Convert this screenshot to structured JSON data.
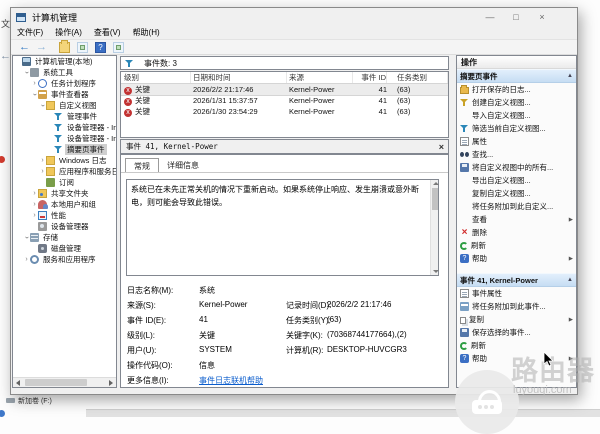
{
  "icons": {
    "chevron": "›",
    "submenu_arrow": "▶",
    "section_collapse": "▲",
    "critical_x": "x",
    "help_q": "?",
    "back_arrow": "←",
    "forward_arrow": "→"
  },
  "colors": {
    "accent_blue": "#3b6fc4",
    "critical_red": "#c23232",
    "link_blue": "#0a5ccc",
    "selection_gray": "#cfcfcf"
  },
  "titlebar": {
    "title": "计算机管理",
    "minimize": "—",
    "maximize": "□",
    "close": "×"
  },
  "menubar": {
    "items": [
      "文件(F)",
      "操作(A)",
      "查看(V)",
      "帮助(H)"
    ]
  },
  "tree": {
    "items": [
      {
        "label": "计算机管理(本地)",
        "level": 0,
        "expand": "",
        "icon": "computer",
        "selected": false
      },
      {
        "label": "系统工具",
        "level": 1,
        "expand": "v",
        "icon": "tools",
        "selected": false
      },
      {
        "label": "任务计划程序",
        "level": 2,
        "expand": ">",
        "icon": "scheduler",
        "selected": false
      },
      {
        "label": "事件查看器",
        "level": 2,
        "expand": "v",
        "icon": "eventvwr",
        "selected": false
      },
      {
        "label": "自定义视图",
        "level": 3,
        "expand": "v",
        "icon": "custom-views",
        "selected": false
      },
      {
        "label": "管理事件",
        "level": 4,
        "expand": "",
        "icon": "filter",
        "selected": false
      },
      {
        "label": "设备管理器 - Int",
        "level": 4,
        "expand": "",
        "icon": "filter",
        "selected": false
      },
      {
        "label": "设备管理器 - Int",
        "level": 4,
        "expand": "",
        "icon": "filter",
        "selected": false
      },
      {
        "label": "摘要页事件",
        "level": 4,
        "expand": "",
        "icon": "filter",
        "selected": true
      },
      {
        "label": "Windows 日志",
        "level": 3,
        "expand": ">",
        "icon": "folder",
        "selected": false
      },
      {
        "label": "应用程序和服务日志",
        "level": 3,
        "expand": ">",
        "icon": "folder",
        "selected": false
      },
      {
        "label": "订阅",
        "level": 3,
        "expand": "",
        "icon": "subscriptions",
        "selected": false
      },
      {
        "label": "共享文件夹",
        "level": 2,
        "expand": ">",
        "icon": "shared-folders",
        "selected": false
      },
      {
        "label": "本地用户和组",
        "level": 2,
        "expand": ">",
        "icon": "users",
        "selected": false
      },
      {
        "label": "性能",
        "level": 2,
        "expand": ">",
        "icon": "performance",
        "selected": false
      },
      {
        "label": "设备管理器",
        "level": 2,
        "expand": "",
        "icon": "device-manager",
        "selected": false
      },
      {
        "label": "存储",
        "level": 1,
        "expand": "v",
        "icon": "storage",
        "selected": false
      },
      {
        "label": "磁盘管理",
        "level": 2,
        "expand": "",
        "icon": "disk",
        "selected": false
      },
      {
        "label": "服务和应用程序",
        "level": 1,
        "expand": ">",
        "icon": "services",
        "selected": false
      }
    ]
  },
  "events": {
    "filter_label": "事件数: 3",
    "columns": [
      "级别",
      "日期和时间",
      "来源",
      "事件 ID",
      "任务类别"
    ],
    "rows": [
      {
        "level": "关键",
        "datetime": "2026/2/2 21:17:46",
        "source": "Kernel-Power",
        "event_id": "41",
        "task_category": "(63)",
        "selected": true
      },
      {
        "level": "关键",
        "datetime": "2026/1/31 15:37:57",
        "source": "Kernel-Power",
        "event_id": "41",
        "task_category": "(63)",
        "selected": false
      },
      {
        "level": "关键",
        "datetime": "2026/1/30 23:54:29",
        "source": "Kernel-Power",
        "event_id": "41",
        "task_category": "(63)",
        "selected": false
      }
    ]
  },
  "detail": {
    "title": "事件 41, Kernel-Power",
    "close": "×",
    "tabs": [
      {
        "label": "常规",
        "active": true
      },
      {
        "label": "详细信息",
        "active": false
      }
    ],
    "description": "系统已在未先正常关机的情况下重新启动。如果系统停止响应、发生崩溃或意外断电，则可能会导致此错误。",
    "fields": [
      {
        "label": "日志名称(M):",
        "value": "系统",
        "label2": "",
        "value2": "",
        "is_link": false
      },
      {
        "label": "来源(S):",
        "value": "Kernel-Power",
        "label2": "记录时间(D):",
        "value2": "2026/2/2 21:17:46",
        "is_link": false
      },
      {
        "label": "事件 ID(E):",
        "value": "41",
        "label2": "任务类别(Y):",
        "value2": "(63)",
        "is_link": false
      },
      {
        "label": "级别(L):",
        "value": "关键",
        "label2": "关键字(K):",
        "value2": "(70368744177664),(2)",
        "is_link": false
      },
      {
        "label": "用户(U):",
        "value": "SYSTEM",
        "label2": "计算机(R):",
        "value2": "DESKTOP-HUVCGR3",
        "is_link": false
      },
      {
        "label": "操作代码(O):",
        "value": "信息",
        "label2": "",
        "value2": "",
        "is_link": false
      },
      {
        "label": "更多信息(I):",
        "value": "事件日志联机帮助",
        "label2": "",
        "value2": "",
        "is_link": true
      }
    ]
  },
  "actions": {
    "title": "操作",
    "sections": [
      {
        "header": "摘要页事件",
        "items": [
          {
            "icon": "open-folder",
            "label": "打开保存的日志...",
            "submenu": false
          },
          {
            "icon": "filter-create",
            "label": "创建自定义视图...",
            "submenu": false
          },
          {
            "icon": "none",
            "label": "导入自定义视图...",
            "submenu": false
          },
          {
            "icon": "filter",
            "label": "筛选当前自定义视图...",
            "submenu": false
          },
          {
            "icon": "properties",
            "label": "属性",
            "submenu": false
          },
          {
            "icon": "find",
            "label": "查找...",
            "submenu": false
          },
          {
            "icon": "save",
            "label": "将自定义视图中的所有...",
            "submenu": false
          },
          {
            "icon": "none",
            "label": "导出自定义视图...",
            "submenu": false
          },
          {
            "icon": "none",
            "label": "复制自定义视图...",
            "submenu": false
          },
          {
            "icon": "none",
            "label": "将任务附加到此自定义...",
            "submenu": false
          },
          {
            "icon": "none",
            "label": "查看",
            "submenu": true
          },
          {
            "icon": "delete",
            "label": "删除",
            "submenu": false
          },
          {
            "icon": "refresh",
            "label": "刷新",
            "submenu": false
          },
          {
            "icon": "help",
            "label": "帮助",
            "submenu": true
          }
        ]
      },
      {
        "header": "事件 41, Kernel-Power",
        "items": [
          {
            "icon": "properties",
            "label": "事件属性",
            "submenu": false
          },
          {
            "icon": "task",
            "label": "将任务附加到此事件...",
            "submenu": false
          },
          {
            "icon": "copy",
            "label": "复制",
            "submenu": true
          },
          {
            "icon": "save",
            "label": "保存选择的事件...",
            "submenu": false
          },
          {
            "icon": "refresh",
            "label": "刷新",
            "submenu": false
          },
          {
            "icon": "help",
            "label": "帮助",
            "submenu": true
          }
        ]
      }
    ]
  },
  "background": {
    "fragment_text": "文",
    "volume_label": "新加卷 (F:)"
  },
  "watermark": {
    "brand": "路由器",
    "domain": "luyouqi.com"
  }
}
